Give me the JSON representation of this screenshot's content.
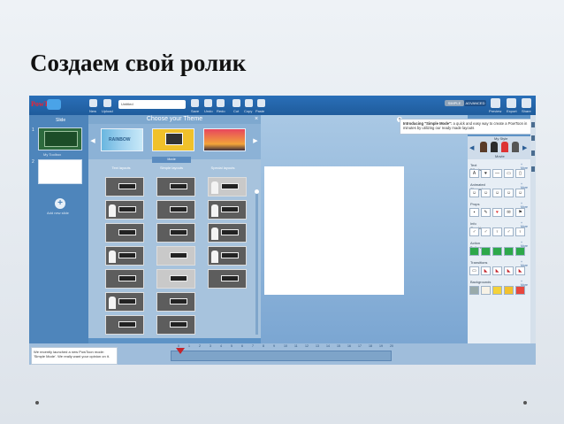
{
  "slide": {
    "title": "Создаем свой ролик"
  },
  "toolbar": {
    "logo": "PowToon",
    "new_label": "New",
    "upload_label": "Upload",
    "project_name": "Untitled",
    "save_label": "Save",
    "undo_label": "Undo",
    "redo_label": "Redo",
    "cut_label": "Cut",
    "copy_label": "Copy",
    "paste_label": "Paste",
    "mode_simple": "SIMPLE",
    "mode_advanced": "ADVANCED",
    "preview_label": "Preview",
    "export_label": "Export",
    "share_label": "Share",
    "social": [
      "f",
      "g+",
      "in"
    ]
  },
  "left_panel": {
    "title": "Slide",
    "slide1_number": "1",
    "slide1_caption": "My Toolbox",
    "slide2_number": "2",
    "add_slide_label": "Add new slide"
  },
  "theme_panel": {
    "header": "Choose your Theme",
    "close": "×",
    "themes": [
      {
        "label": "RAINBOW"
      },
      {
        "label": "Movie"
      },
      {
        "label": ""
      }
    ],
    "selected_label": "Movie",
    "columns": [
      "Text layouts",
      "Simple layouts",
      "Special layouts"
    ]
  },
  "tooltip": {
    "bold": "Introducing \"Simple Mode\":",
    "text": " a quick and easy way to create a PowToon in minutes by utilizing our ready made layouts"
  },
  "right_panel": {
    "character_name": "My Style",
    "character_sub": "Movie",
    "sections": [
      {
        "title": "Text Effects",
        "more": "+ More"
      },
      {
        "title": "Animated Characters",
        "more": "+ More"
      },
      {
        "title": "Props",
        "more": "+ More"
      },
      {
        "title": "Info Graphics",
        "more": "+ More"
      },
      {
        "title": "Action Buttons",
        "more": "+ More"
      },
      {
        "title": "Transitions",
        "more": "+ More"
      },
      {
        "title": "Backgrounds",
        "more": "+ More"
      }
    ]
  },
  "info_box": {
    "text": "We recently launched a new PowToon mode: 'Simple Mode'. We really want your opinion on it."
  },
  "timeline": {
    "ticks": [
      "0",
      "1",
      "2",
      "3",
      "4",
      "5",
      "6",
      "7",
      "8",
      "9",
      "10",
      "11",
      "12",
      "13",
      "14",
      "15",
      "16",
      "17",
      "18",
      "19",
      "20"
    ]
  },
  "colors": {
    "toolbar": "#2a6fb8",
    "accent_red": "#c4242c",
    "canvas_bg": "#a9c8e4"
  }
}
